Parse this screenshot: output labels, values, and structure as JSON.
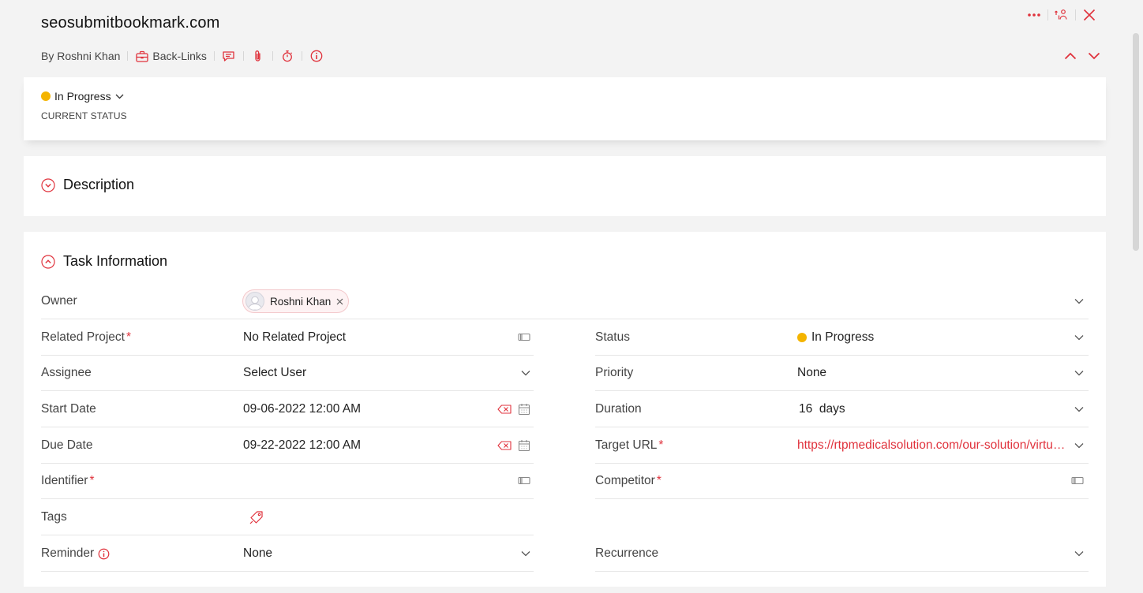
{
  "header": {
    "title": "seosubmitbookmark.com",
    "author": "By Roshni Khan",
    "tasklist": "Back-Links"
  },
  "current_status": {
    "value": "In Progress",
    "caption": "CURRENT STATUS",
    "dot_color": "#f4b400"
  },
  "sections": {
    "description": "Description",
    "task_information": "Task Information"
  },
  "fields": {
    "owner": {
      "label": "Owner",
      "chip": "Roshni Khan"
    },
    "related_project": {
      "label": "Related Project",
      "required": "*",
      "value": "No Related Project"
    },
    "status": {
      "label": "Status",
      "value": "In Progress"
    },
    "assignee": {
      "label": "Assignee",
      "value": "Select User"
    },
    "priority": {
      "label": "Priority",
      "value": "None"
    },
    "start_date": {
      "label": "Start Date",
      "value": "09-06-2022 12:00 AM"
    },
    "duration": {
      "label": "Duration",
      "value": "16  days"
    },
    "due_date": {
      "label": "Due Date",
      "value": "09-22-2022 12:00 AM"
    },
    "target_url": {
      "label": "Target URL",
      "required": "*",
      "value": "https://rtpmedicalsolution.com/our-solution/virtual-medical-scribe/"
    },
    "identifier": {
      "label": "Identifier",
      "required": "*",
      "value": ""
    },
    "competitor": {
      "label": "Competitor",
      "required": "*",
      "value": ""
    },
    "tags": {
      "label": "Tags"
    },
    "reminder": {
      "label": "Reminder",
      "value": "None"
    },
    "recurrence": {
      "label": "Recurrence",
      "value": ""
    }
  },
  "colors": {
    "accent": "#e0323c",
    "status_in_progress": "#f4b400",
    "background": "#f3f3f3"
  },
  "icons": {
    "more": "more-horizontal-icon",
    "share": "share-people-icon",
    "close": "close-icon",
    "comment": "comment-icon",
    "attachment": "paperclip-icon",
    "timer": "stopwatch-icon",
    "info": "info-icon",
    "collapse": "chevron-circle-icon",
    "calendar": "calendar-icon",
    "clear": "backspace-clear-icon",
    "tag": "tag-icon"
  }
}
